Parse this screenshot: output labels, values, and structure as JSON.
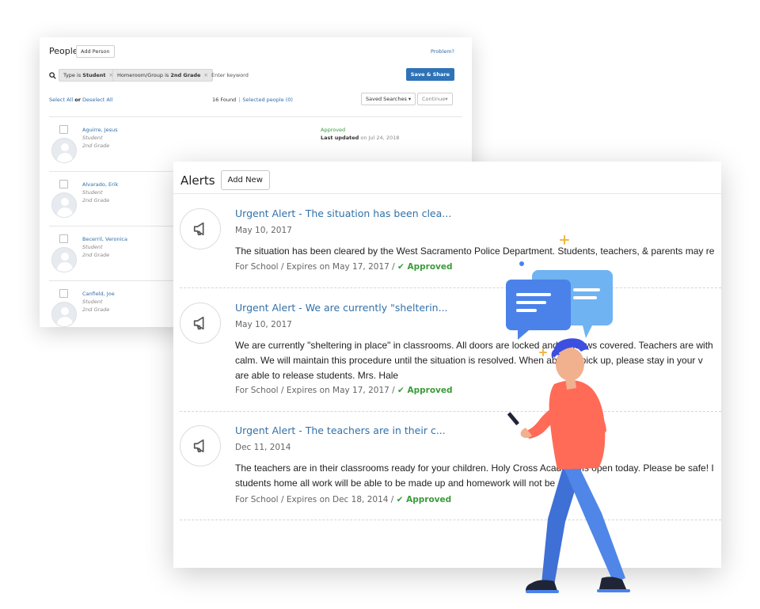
{
  "people": {
    "title": "People",
    "add_person_label": "Add Person",
    "problem_link": "Problem?",
    "filters": [
      {
        "field": "Type",
        "op": "is",
        "value": "Student"
      },
      {
        "field": "Homeroom/Group",
        "op": "is",
        "value": "2nd Grade"
      }
    ],
    "keyword_placeholder": "Enter keyword",
    "save_share_label": "Save & Share",
    "select_all": "Select All",
    "or": "or",
    "deselect_all": "Deselect All",
    "found_text": "16 Found",
    "selected_people": "Selected people (0)",
    "saved_searches_label": "Saved Searches ▾",
    "continue_label": "Continue▾",
    "rows": [
      {
        "name": "Aguirre, Jesus",
        "role": "Student",
        "grade": "2nd Grade",
        "status": "Approved",
        "updated_label": "Last updated",
        "updated_on": "on Jul 24, 2018"
      },
      {
        "name": "Alvarado, Erik",
        "role": "Student",
        "grade": "2nd Grade",
        "status": "",
        "updated_label": "",
        "updated_on": ""
      },
      {
        "name": "Becerril, Veronica",
        "role": "Student",
        "grade": "2nd Grade",
        "status": "",
        "updated_label": "",
        "updated_on": ""
      },
      {
        "name": "Canfield, Joe",
        "role": "Student",
        "grade": "2nd Grade",
        "status": "",
        "updated_label": "",
        "updated_on": ""
      }
    ]
  },
  "alerts": {
    "title": "Alerts",
    "add_new_label": "Add New",
    "items": [
      {
        "headline": "Urgent Alert - The situation has been clea...",
        "date": "May 10, 2017",
        "body": "The situation has been cleared by the West Sacramento Police Department. Students, teachers, & parents may re",
        "meta": "For School / Expires on May 17, 2017 /",
        "status": "✔ Approved"
      },
      {
        "headline": "Urgent Alert - We are currently \"shelterin...",
        "date": "May 10, 2017",
        "body": "We are currently \"sheltering in place\" in classrooms. All doors are locked and windows covered. Teachers are with\ncalm. We will maintain this procedure until the situation is resolved. When able for pick up, please stay in your v\nare able to release students. Mrs. Hale",
        "meta": "For School / Expires on May 17, 2017 /",
        "status": "✔ Approved"
      },
      {
        "headline": "Urgent Alert - The teachers are in their c...",
        "date": "Dec 11, 2014",
        "body": "The teachers are in their classrooms ready for your children. Holy Cross Academy is open today. Please be safe! I\nstudents home all work will be able to be made up and homework will not be",
        "meta": "For School / Expires on Dec 18, 2014 /",
        "status": "✔ Approved"
      }
    ]
  },
  "colors": {
    "accent_blue": "#2e73b8",
    "link_blue": "#3271a8",
    "approved_green": "#3a9b3a",
    "bubble_blue": "#4a82ea",
    "bubble_light": "#6fb3f3",
    "shirt_orange": "#ff6b57",
    "pants_blue": "#4f86e8"
  },
  "icons": [
    "search-icon",
    "megaphone-icon",
    "checkmark-icon",
    "chat-bubble-icon"
  ]
}
